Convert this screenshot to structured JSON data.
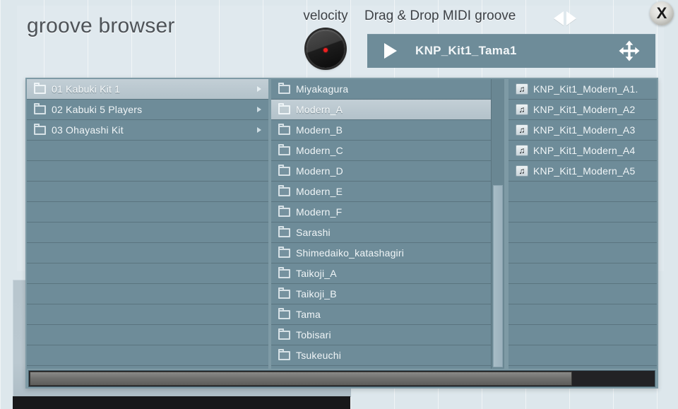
{
  "header": {
    "title": "groove browser",
    "velocity_label": "velocity",
    "dragdrop_label": "Drag & Drop MIDI groove",
    "prev_arrow_icon": "triangle-left-icon",
    "next_arrow_icon": "triangle-right-icon",
    "close_label": "X",
    "close_icon": "close-icon",
    "knob_icon": "velocity-knob-icon"
  },
  "groove_slot": {
    "play_icon": "play-icon",
    "name": "KNP_Kit1_Tama1",
    "drag_icon": "move-drag-icon"
  },
  "columns": {
    "kits": {
      "name": "kits-column",
      "selected_index": 0,
      "items": [
        {
          "label": "01 Kabuki Kit 1",
          "icon": "folder-icon",
          "has_arrow": true
        },
        {
          "label": "02 Kabuki 5 Players",
          "icon": "folder-icon",
          "has_arrow": true
        },
        {
          "label": "03 Ohayashi Kit",
          "icon": "folder-icon",
          "has_arrow": true
        }
      ],
      "empty_rows": 11
    },
    "styles": {
      "name": "styles-column",
      "selected_index": 1,
      "items": [
        {
          "label": "Miyakagura",
          "icon": "folder-icon",
          "has_arrow": true
        },
        {
          "label": "Modern_A",
          "icon": "folder-icon",
          "has_arrow": true
        },
        {
          "label": "Modern_B",
          "icon": "folder-icon",
          "has_arrow": true
        },
        {
          "label": "Modern_C",
          "icon": "folder-icon",
          "has_arrow": true
        },
        {
          "label": "Modern_D",
          "icon": "folder-icon",
          "has_arrow": true
        },
        {
          "label": "Modern_E",
          "icon": "folder-icon",
          "has_arrow": true
        },
        {
          "label": "Modern_F",
          "icon": "folder-icon",
          "has_arrow": true
        },
        {
          "label": "Sarashi",
          "icon": "folder-icon",
          "has_arrow": true
        },
        {
          "label": "Shimedaiko_katashagiri",
          "icon": "folder-icon",
          "has_arrow": true
        },
        {
          "label": "Taikoji_A",
          "icon": "folder-icon",
          "has_arrow": true
        },
        {
          "label": "Taikoji_B",
          "icon": "folder-icon",
          "has_arrow": true
        },
        {
          "label": "Tama",
          "icon": "folder-icon",
          "has_arrow": true
        },
        {
          "label": "Tobisari",
          "icon": "folder-icon",
          "has_arrow": true
        },
        {
          "label": "Tsukeuchi",
          "icon": "folder-icon",
          "has_arrow": true
        }
      ],
      "empty_rows": 0,
      "scrollbar": "styles-scrollbar"
    },
    "files": {
      "name": "files-column",
      "selected_index": -1,
      "items": [
        {
          "label": "KNP_Kit1_Modern_A1.",
          "icon": "midi-note-icon",
          "has_arrow": false
        },
        {
          "label": "KNP_Kit1_Modern_A2",
          "icon": "midi-note-icon",
          "has_arrow": false
        },
        {
          "label": "KNP_Kit1_Modern_A3",
          "icon": "midi-note-icon",
          "has_arrow": false
        },
        {
          "label": "KNP_Kit1_Modern_A4",
          "icon": "midi-note-icon",
          "has_arrow": false
        },
        {
          "label": "KNP_Kit1_Modern_A5",
          "icon": "midi-note-icon",
          "has_arrow": false
        }
      ],
      "empty_rows": 9
    }
  },
  "scrollbars": {
    "horizontal": "browser-horizontal-scrollbar",
    "horizontal_thumb": "browser-horizontal-scroll-thumb"
  },
  "colors": {
    "app_background": "#dde7ec",
    "panel": "#7e9aa5",
    "row": "#6e8c99",
    "row_selected": "#b8c6ce",
    "row_text": "#f0f5f7",
    "title_text": "#4e5358",
    "knob_indicator": "#ee2020",
    "scroll_track": "#222225"
  }
}
